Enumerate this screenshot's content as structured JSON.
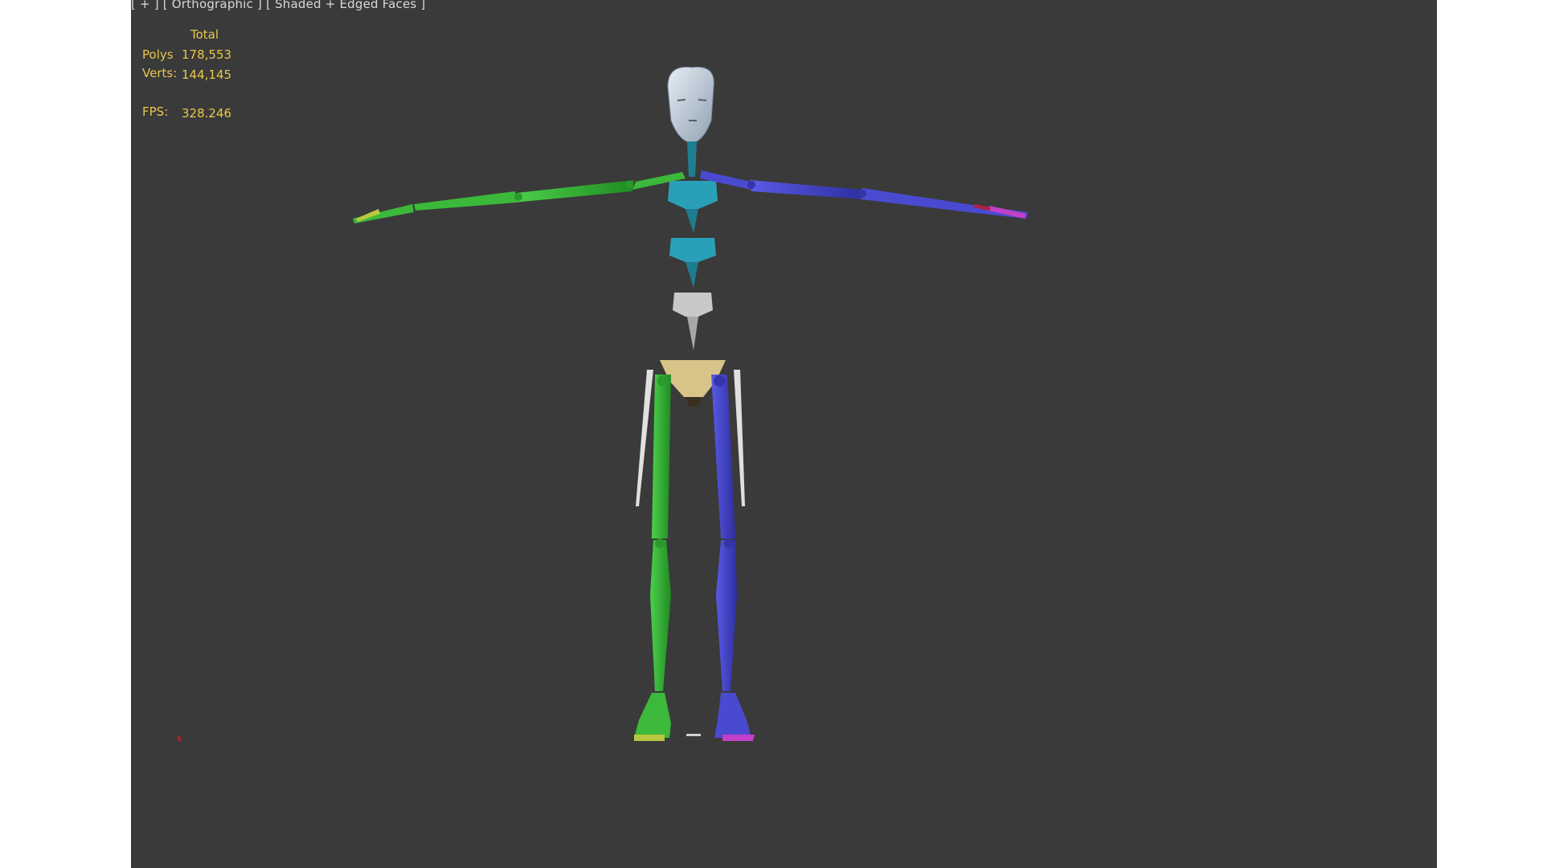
{
  "viewport": {
    "label_plus": "[ + ]",
    "label_view": "[ Orthographic ]",
    "label_shading": "[ Shaded + Edged Faces ]"
  },
  "stats": {
    "header": "Total",
    "polys_label": "Polys",
    "polys_value": "178,553",
    "verts_label": "Verts:",
    "verts_value": "144,145",
    "fps_label": "FPS:",
    "fps_value": "328.246"
  },
  "colors": {
    "viewport_bg": "#3a3a3a",
    "stats_text": "#e8c84a",
    "left_side": "#3cb83a",
    "right_side": "#4a4ad0",
    "spine": "#2aa0b8",
    "pelvis": "#d8c488",
    "head": "#c8d4e0"
  },
  "scene": {
    "object": "biped-skeleton",
    "pose": "t-pose"
  }
}
